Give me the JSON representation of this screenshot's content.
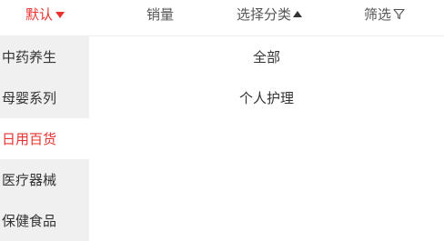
{
  "tabs": {
    "default": "默认",
    "sales": "销量",
    "category": "选择分类",
    "filter": "筛选"
  },
  "sidebar": {
    "items": [
      {
        "label": "中药养生"
      },
      {
        "label": "母婴系列"
      },
      {
        "label": "日用百货"
      },
      {
        "label": "医疗器械"
      },
      {
        "label": "保健食品"
      }
    ],
    "selected": "日用百货"
  },
  "subcategories": [
    {
      "label": "全部"
    },
    {
      "label": "个人护理"
    }
  ],
  "colors": {
    "accent": "#e8322f",
    "sidebar_bg": "#f0f0f0",
    "text": "#333333"
  }
}
